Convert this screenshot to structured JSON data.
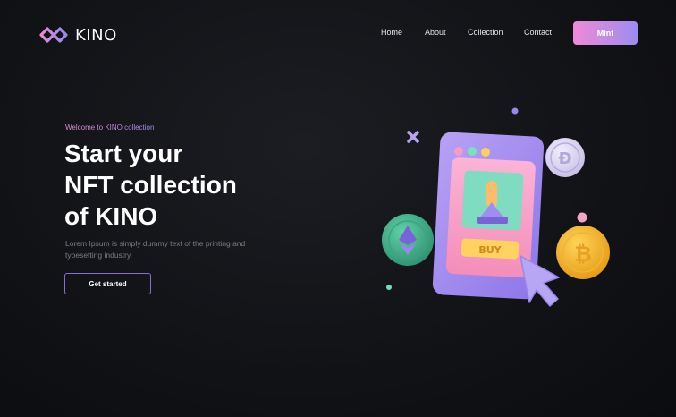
{
  "brand": {
    "name": "KINO"
  },
  "nav": {
    "links": [
      "Home",
      "About",
      "Collection",
      "Contact"
    ],
    "cta_label": "Mint"
  },
  "hero": {
    "eyebrow": "Welcome to KINO collection",
    "headline_lines": [
      "Start your",
      "NFT collection",
      "of KINO"
    ],
    "description": "Lorem Ipsum is simply dummy text of the printing and typesetting industry.",
    "cta_label": "Get started"
  },
  "illustration": {
    "buy_label": "BUY",
    "icons": [
      "sparkle-x-icon",
      "dogecoin-coin-icon",
      "ethereum-coin-icon",
      "bitcoin-coin-icon",
      "phone-nft-icon",
      "cursor-arrow-icon"
    ]
  },
  "colors": {
    "accent_pink": "#f08ad6",
    "accent_purple": "#9b8cf0",
    "background": "#121317"
  }
}
